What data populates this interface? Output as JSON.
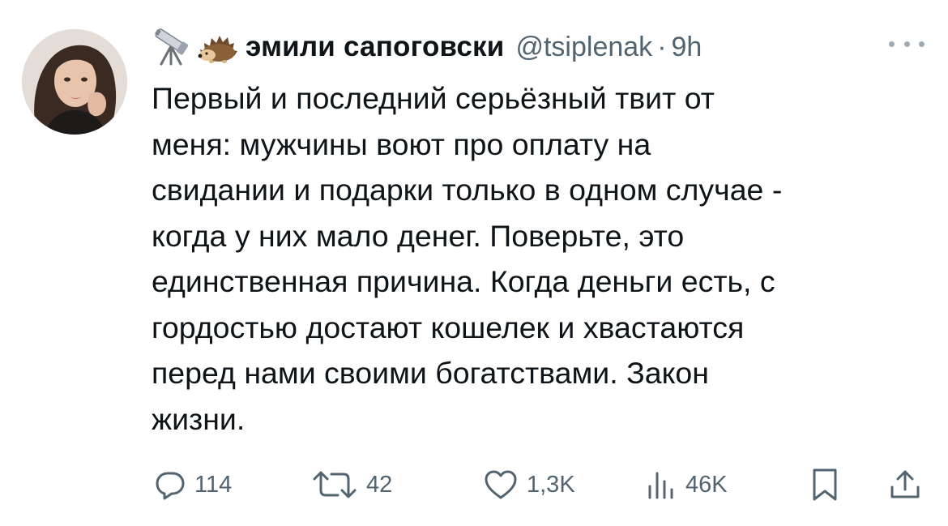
{
  "tweet": {
    "display_name": "эмили сапоговски",
    "handle": "@tsiplenak",
    "separator": "·",
    "time": "9h",
    "emoji": [
      "telescope-emoji",
      "hedgehog-emoji"
    ],
    "text_lines": [
      "Первый и последний серьёзный твит от",
      "меня: мужчины воют про оплату на",
      "свидании и подарки только в одном случае -",
      "когда у них мало денег. Поверьте, это",
      "единственная причина. Когда деньги есть, с",
      "гордостью достают кошелек и хвастаются",
      "перед нами своими богатствами. Закон",
      "жизни."
    ]
  },
  "actions": {
    "replies": "114",
    "retweets": "42",
    "likes": "1,3K",
    "views": "46K"
  },
  "icons": {
    "reply": "reply-icon",
    "retweet": "retweet-icon",
    "like": "heart-icon",
    "views": "views-icon",
    "bookmark": "bookmark-icon",
    "share": "share-icon",
    "more": "more-icon"
  },
  "colors": {
    "text": "#0f1419",
    "secondary": "#536471",
    "background": "#ffffff"
  }
}
